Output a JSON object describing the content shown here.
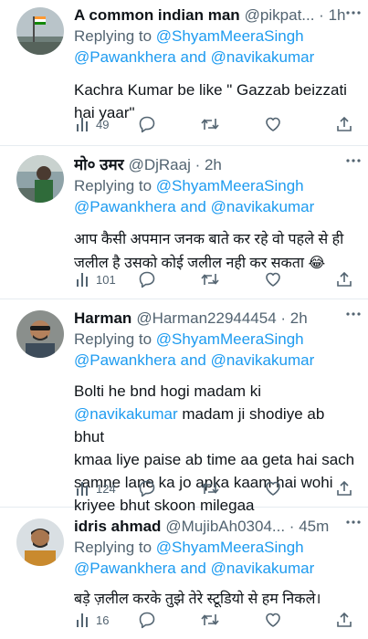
{
  "tweets": [
    {
      "name": "A common indian man",
      "meta": "@pikpat... · 1h",
      "reply_prefix": "Replying to",
      "reply_to_1": "@ShyamMeeraSingh",
      "reply_to_2": "@Pawankhera",
      "reply_and": "and",
      "reply_to_3": "@navikakumar",
      "text_lines": [
        "Kachra Kumar be like \" Gazzab beizzati",
        "hai yaar\""
      ],
      "views": "49"
    },
    {
      "name": "मो० उमर",
      "meta": "@DjRaaj · 2h",
      "reply_prefix": "Replying to",
      "reply_to_1": "@ShyamMeeraSingh",
      "reply_to_2": "@Pawankhera",
      "reply_and": "and",
      "reply_to_3": "@navikakumar",
      "text_lines": [
        "आप कैसी अपमान जनक बाते कर रहे वो पहले से ही",
        "जलील है उसको कोई जलील नही कर सकता 😂"
      ],
      "views": "101"
    },
    {
      "name": "Harman",
      "meta": "@Harman22944454 · 2h",
      "reply_prefix": "Replying to",
      "reply_to_1": "@ShyamMeeraSingh",
      "reply_to_2": "@Pawankhera",
      "reply_and": "and",
      "reply_to_3": "@navikakumar",
      "text_lines": [
        "Bolti he bnd hogi madam ki"
      ],
      "text_mention": "@navikakumar",
      "text_after_mention": " madam ji shodiye ab bhut",
      "text_lines_2": [
        "kmaa liye paise ab time aa geta hai sach",
        "samne lane ka jo apka kaam hai wohi",
        "kriyee bhut skoon milegaa"
      ],
      "views": "124"
    },
    {
      "name": "idris ahmad",
      "meta": "@MujibAh0304... · 45m",
      "reply_prefix": "Replying to",
      "reply_to_1": "@ShyamMeeraSingh",
      "reply_to_2": "@Pawankhera",
      "reply_and": "and",
      "reply_to_3": "@navikakumar",
      "text_lines": [
        "बड़े ज़लील करके तुझे तेरे स्टूडियो से हम निकले।"
      ],
      "views": "16"
    }
  ],
  "icons": {
    "views": "bar-chart-icon",
    "reply": "speech-bubble-icon",
    "retweet": "retweet-arrows-icon",
    "like": "heart-icon",
    "share": "share-upload-icon",
    "more": "three-dots-icon"
  },
  "colors": {
    "link": "#1d9bf0",
    "secondary": "#536471",
    "text": "#0f1419",
    "divider": "#e6ecf0"
  }
}
